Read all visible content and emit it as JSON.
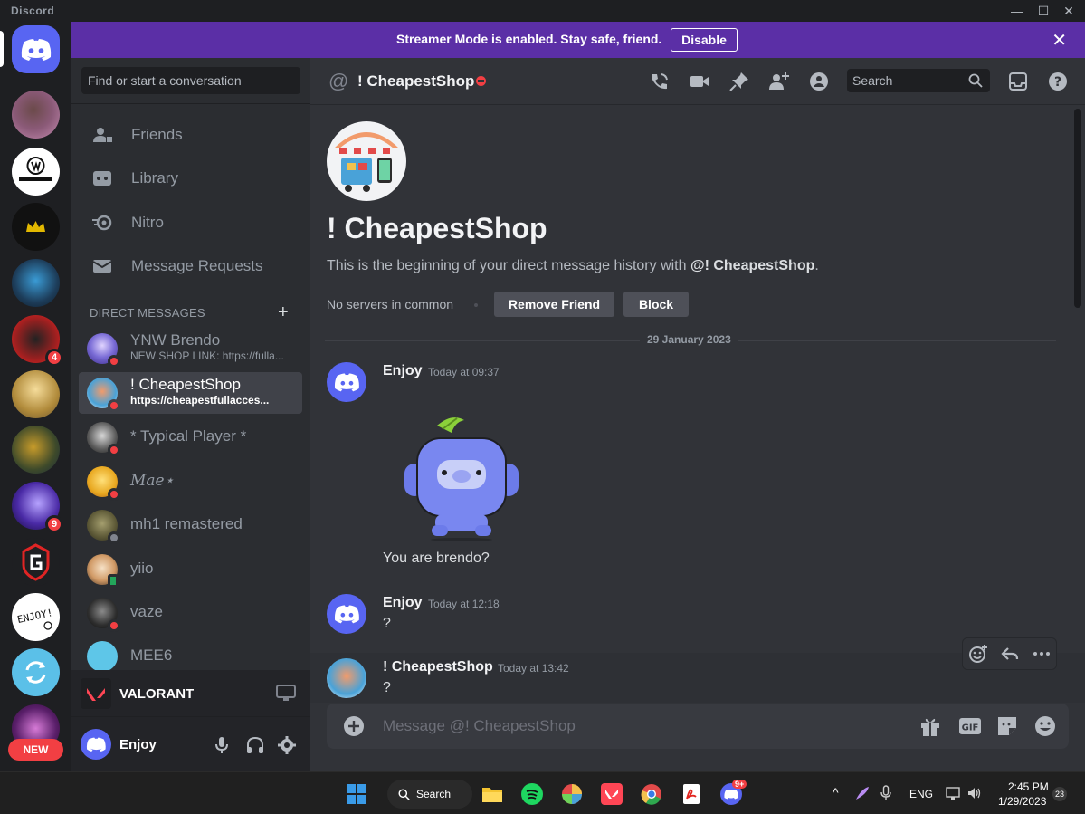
{
  "window": {
    "brand": "Discord",
    "minimize": "—",
    "maximize": "☐",
    "close": "✕"
  },
  "streamer": {
    "message": "Streamer Mode is enabled. Stay safe, friend.",
    "disable": "Disable",
    "close": "✕"
  },
  "rail": {
    "new_badge": "NEW",
    "badges": [
      "4",
      "9"
    ]
  },
  "sidebar": {
    "search_placeholder": "Find or start a conversation",
    "nav": [
      {
        "label": "Friends",
        "icon": "friends-icon"
      },
      {
        "label": "Library",
        "icon": "library-icon"
      },
      {
        "label": "Nitro",
        "icon": "nitro-icon"
      },
      {
        "label": "Message Requests",
        "icon": "envelope-icon"
      }
    ],
    "dm_header": "DIRECT MESSAGES",
    "dm_add": "+",
    "dms": [
      {
        "name": "YNW Brendo",
        "sub": "NEW SHOP LINK: https://fulla..."
      },
      {
        "name": "! CheapestShop",
        "sub": "https://cheapestfullacces..."
      },
      {
        "name": "* Typical Player *",
        "sub": ""
      },
      {
        "name": "Mae⋆",
        "sub": ""
      },
      {
        "name": "mh1 remastered",
        "sub": ""
      },
      {
        "name": "yiio",
        "sub": ""
      },
      {
        "name": "vaze",
        "sub": ""
      },
      {
        "name": "MEE6",
        "sub": ""
      }
    ],
    "now_playing": "VALORANT",
    "user": "Enjoy"
  },
  "main": {
    "header_at": "@",
    "header_title": "! CheapestShop",
    "search_placeholder": "Search",
    "intro_name": "! CheapestShop",
    "intro_desc_prefix": "This is the beginning of your direct message history with ",
    "intro_desc_name": "@! CheapestShop",
    "intro_desc_suffix": ".",
    "common": "No servers in common",
    "remove_friend": "Remove Friend",
    "block": "Block",
    "date_divider": "29 January 2023",
    "messages": [
      {
        "author": "Enjoy",
        "time": "Today at 09:37",
        "text": "You are brendo?"
      },
      {
        "author": "Enjoy",
        "time": "Today at 12:18",
        "text": "?"
      },
      {
        "author": "! CheapestShop",
        "time": "Today at 13:42",
        "text": "?"
      }
    ],
    "composer_placeholder": "Message @! CheapestShop",
    "gif": "GIF"
  },
  "taskbar": {
    "search": "Search",
    "lang": "ENG",
    "time": "2:45 PM",
    "date": "1/29/2023",
    "notif_count": "23",
    "discord_badge": "9+"
  },
  "colors": {
    "blurple": "#5865f2",
    "streamer": "#5b2fa6",
    "dnd": "#f23f43",
    "online": "#23a55a"
  }
}
